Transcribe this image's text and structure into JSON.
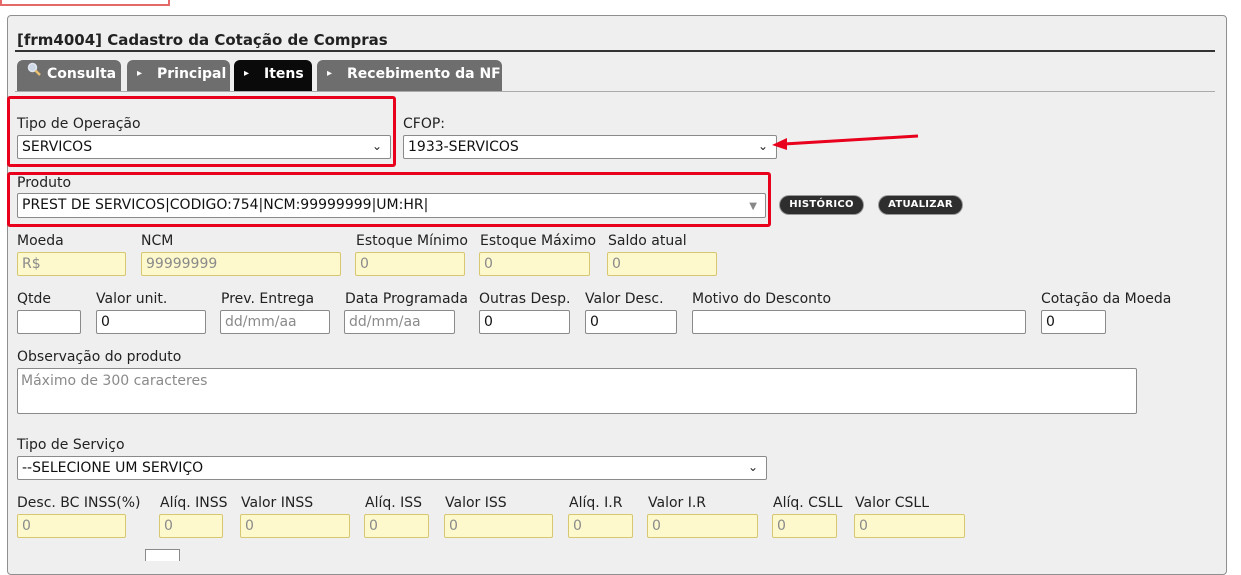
{
  "window": {
    "title": "[frm4004] Cadastro da Cotação de Compras"
  },
  "tabs": [
    {
      "label": "Consulta",
      "icon": "search-icon"
    },
    {
      "label": "Principal",
      "icon": "triangle-right-icon"
    },
    {
      "label": "Itens",
      "icon": "triangle-right-icon"
    },
    {
      "label": "Recebimento da NF",
      "icon": "triangle-right-icon"
    }
  ],
  "form": {
    "tipo_operacao": {
      "label": "Tipo de Operação",
      "value": "SERVICOS"
    },
    "cfop": {
      "label": "CFOP:",
      "value": "1933-SERVICOS"
    },
    "produto": {
      "label": "Produto",
      "value": "PREST DE SERVICOS|CODIGO:754|NCM:99999999|UM:HR|"
    },
    "buttons": {
      "historico": "HISTÓRICO",
      "atualizar": "ATUALIZAR"
    },
    "row1": {
      "moeda": {
        "label": "Moeda",
        "value": "R$"
      },
      "ncm": {
        "label": "NCM",
        "value": "99999999"
      },
      "estoque_minimo": {
        "label": "Estoque Mínimo",
        "value": "0"
      },
      "estoque_maximo": {
        "label": "Estoque Máximo",
        "value": "0"
      },
      "saldo_atual": {
        "label": "Saldo atual",
        "value": "0"
      }
    },
    "row2": {
      "qtde": {
        "label": "Qtde",
        "value": ""
      },
      "valor_unit": {
        "label": "Valor unit.",
        "value": "0"
      },
      "prev_entrega": {
        "label": "Prev. Entrega",
        "placeholder": "dd/mm/aa"
      },
      "data_programada": {
        "label": "Data Programada",
        "placeholder": "dd/mm/aa"
      },
      "outras_desp": {
        "label": "Outras Desp.",
        "value": "0"
      },
      "valor_desc": {
        "label": "Valor Desc.",
        "value": "0"
      },
      "motivo_desconto": {
        "label": "Motivo do Desconto",
        "value": ""
      },
      "cotacao_moeda": {
        "label": "Cotação da Moeda",
        "value": "0"
      }
    },
    "observacao": {
      "label": "Observação do produto",
      "placeholder": "Máximo de 300 caracteres"
    },
    "tipo_servico": {
      "label": "Tipo de Serviço",
      "value": "--SELECIONE UM SERVIÇO"
    },
    "row3": {
      "desc_bc_inss": {
        "label": "Desc. BC INSS(%)",
        "value": "0"
      },
      "aliq_inss": {
        "label": "Alíq. INSS",
        "value": "0"
      },
      "valor_inss": {
        "label": "Valor INSS",
        "value": "0"
      },
      "aliq_iss": {
        "label": "Alíq. ISS",
        "value": "0"
      },
      "valor_iss": {
        "label": "Valor ISS",
        "value": "0"
      },
      "aliq_ir": {
        "label": "Alíq. I.R",
        "value": "0"
      },
      "valor_ir": {
        "label": "Valor I.R",
        "value": "0"
      },
      "aliq_csll": {
        "label": "Alíq. CSLL",
        "value": "0"
      },
      "valor_csll": {
        "label": "Valor CSLL",
        "value": "0"
      }
    }
  },
  "colors": {
    "highlight": "#e8001c",
    "readonly_bg": "#fdf9cd",
    "tab_bg": "#6e6e6e",
    "tab_active": "#0a0a0a"
  }
}
